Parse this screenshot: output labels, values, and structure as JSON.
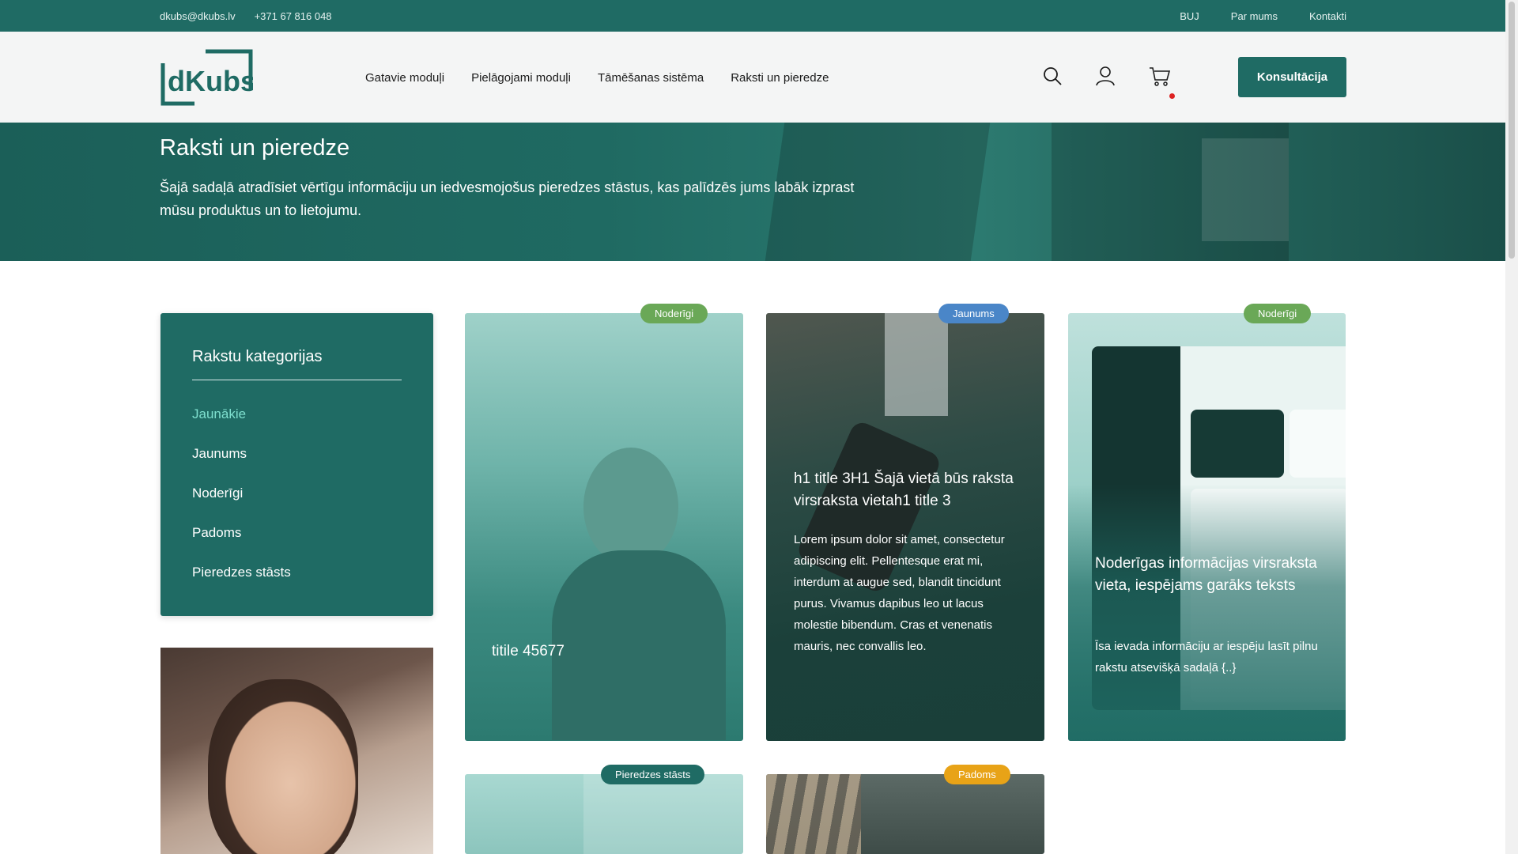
{
  "topbar": {
    "email": "dkubs@dkubs.lv",
    "phone": "+371 67 816 048",
    "links": [
      "BUJ",
      "Par mums",
      "Kontakti"
    ]
  },
  "header": {
    "logo_text": "dKubs",
    "nav": [
      "Gatavie moduļi",
      "Pielāgojami moduļi",
      "Tāmēšanas sistēma",
      "Raksti un pieredze"
    ],
    "icons": [
      "search-icon",
      "user-icon",
      "cart-icon"
    ],
    "cta_label": "Konsultācija"
  },
  "hero": {
    "title": "Raksti un pieredze",
    "text": "Šajā sadaļā atradīsiet vērtīgu informāciju un iedvesmojošus pieredzes stāstus, kas palīdzēs jums labāk izprast mūsu produktus un to lietojumu."
  },
  "sidebar": {
    "title": "Rakstu kategorijas",
    "categories": [
      "Jaunākie",
      "Jaunums",
      "Noderīgi",
      "Padoms",
      "Pieredzes stāsts"
    ],
    "active_category": "Jaunākie"
  },
  "cards": [
    {
      "badge": "Noderīgi",
      "badge_color": "#6aa857",
      "title": "titile 45677",
      "text": ""
    },
    {
      "badge": "Jaunums",
      "badge_color": "#4a86c8",
      "title": "h1 title 3H1 Šajā vietā būs raksta virsraksta vietah1 title 3",
      "text": "Lorem ipsum dolor sit amet, consectetur adipiscing elit. Pellentesque erat mi, interdum at augue sed, blandit tincidunt purus. Vivamus dapibus leo ut lacus molestie bibendum. Cras et venenatis mauris, nec convallis leo."
    },
    {
      "badge": "Noderīgi",
      "badge_color": "#6aa857",
      "title": "Noderīgas informācijas virsraksta vieta, iespējams garāks teksts",
      "text": "Īsa ievada informāciju ar iespēju lasīt pilnu rakstu atsevišķā sadaļā {..}"
    },
    {
      "badge": "Pieredzes stāsts",
      "badge_color": "#1f6b64",
      "title": "",
      "text": ""
    },
    {
      "badge": "Padoms",
      "badge_color": "#e8a317",
      "title": "",
      "text": ""
    }
  ],
  "colors": {
    "brand": "#1f6b64",
    "accent_active": "#7fe0cf",
    "cart_dot": "#dd2222"
  }
}
